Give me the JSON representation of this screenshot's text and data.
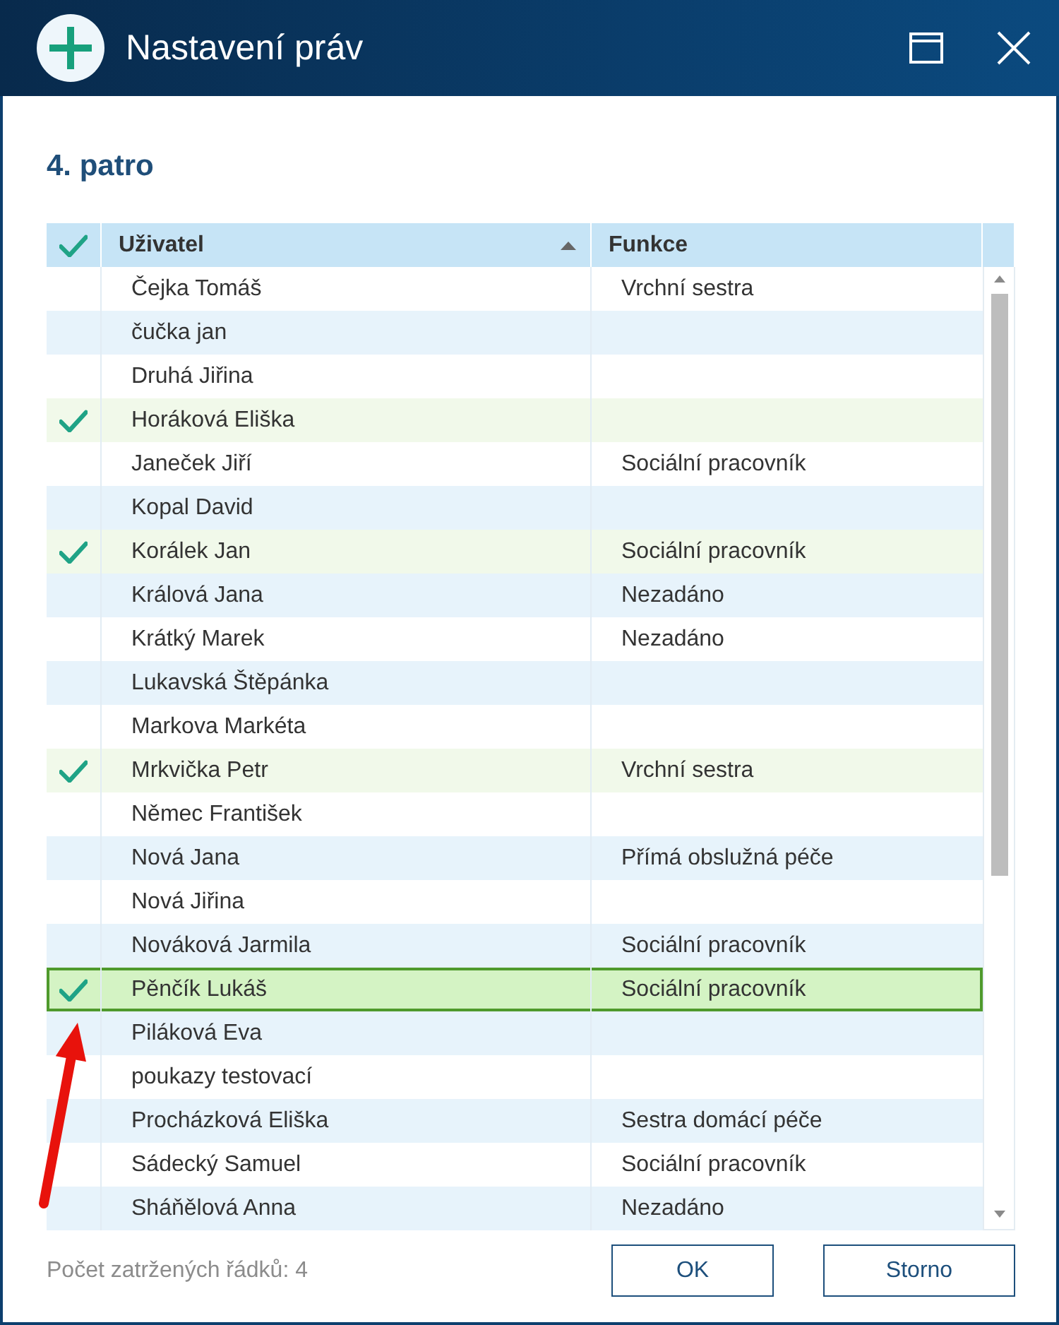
{
  "window": {
    "title": "Nastavení práv"
  },
  "heading": "4. patro",
  "table": {
    "columns": [
      {
        "label": "Uživatel",
        "sorted": true
      },
      {
        "label": "Funkce",
        "sorted": false
      }
    ],
    "rows": [
      {
        "user": "Čejka Tomáš",
        "function": "Vrchní sestra",
        "checked": false,
        "selected": false
      },
      {
        "user": "čučka jan",
        "checked": false,
        "selected": false
      },
      {
        "user": "Druhá Jiřina",
        "checked": false,
        "selected": false
      },
      {
        "user": "Horáková Eliška",
        "checked": true,
        "selected": false
      },
      {
        "user": "Janeček Jiří",
        "function": "Sociální pracovník",
        "checked": false,
        "selected": false
      },
      {
        "user": "Kopal David",
        "checked": false,
        "selected": false
      },
      {
        "user": "Korálek Jan",
        "function": "Sociální pracovník",
        "checked": true,
        "selected": false
      },
      {
        "user": "Králová Jana",
        "function": "Nezadáno",
        "checked": false,
        "selected": false
      },
      {
        "user": "Krátký Marek",
        "function": "Nezadáno",
        "checked": false,
        "selected": false
      },
      {
        "user": "Lukavská Štěpánka",
        "checked": false,
        "selected": false
      },
      {
        "user": "Markova Markéta",
        "checked": false,
        "selected": false
      },
      {
        "user": "Mrkvička Petr",
        "function": "Vrchní sestra",
        "checked": true,
        "selected": false
      },
      {
        "user": "Němec František",
        "checked": false,
        "selected": false
      },
      {
        "user": "Nová Jana",
        "function": "Přímá obslužná péče",
        "checked": false,
        "selected": false
      },
      {
        "user": "Nová Jiřina",
        "checked": false,
        "selected": false
      },
      {
        "user": "Nováková Jarmila",
        "function": "Sociální pracovník",
        "checked": false,
        "selected": false
      },
      {
        "user": "Pěnčík Lukáš",
        "function": "Sociální pracovník",
        "checked": true,
        "selected": true
      },
      {
        "user": "Piláková Eva",
        "checked": false,
        "selected": false
      },
      {
        "user": "poukazy testovací",
        "checked": false,
        "selected": false
      },
      {
        "user": "Procházková Eliška",
        "function": "Sestra domácí péče",
        "checked": false,
        "selected": false
      },
      {
        "user": "Sádecký Samuel",
        "function": "Sociální pracovník",
        "checked": false,
        "selected": false
      },
      {
        "user": "Sháňělová Anna",
        "function": "Nezadáno",
        "checked": false,
        "selected": false
      }
    ]
  },
  "footer": {
    "count": "Počet zatržených řádků: 4",
    "buttons": [
      {
        "label": "OK"
      },
      {
        "label": "Storno"
      }
    ]
  }
}
